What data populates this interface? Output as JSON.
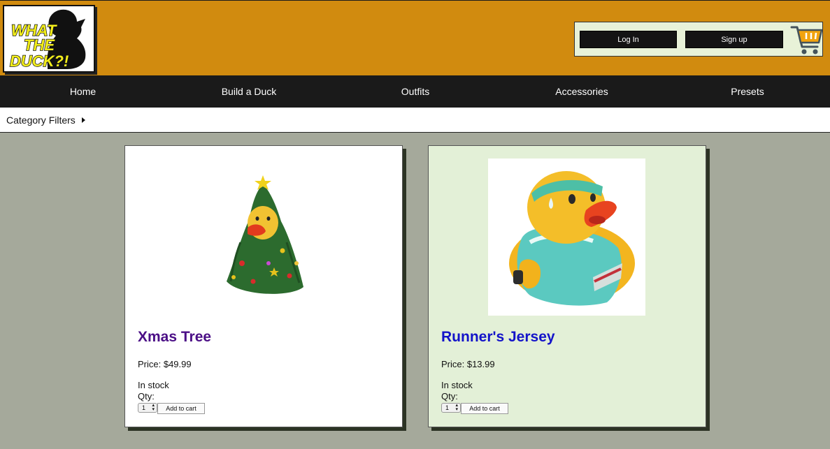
{
  "header": {
    "logo": {
      "text_lines": [
        "WHAT",
        "THE",
        "DUCK?!"
      ],
      "mark": "®",
      "icon": "duck-silhouette-icon"
    },
    "auth": {
      "login_label": "Log In",
      "signup_label": "Sign up"
    },
    "cart": {
      "icon": "shopping-cart-icon"
    }
  },
  "nav": {
    "items": [
      {
        "label": "Home"
      },
      {
        "label": "Build a Duck"
      },
      {
        "label": "Outfits"
      },
      {
        "label": "Accessories"
      },
      {
        "label": "Presets"
      }
    ]
  },
  "filters": {
    "label": "Category Filters",
    "icon": "caret-right-icon"
  },
  "products": [
    {
      "title": "Xmas Tree",
      "price": "Price: $49.99",
      "stock": "In stock",
      "qty_label": "Qty:",
      "qty_value": "1",
      "add_label": "Add to cart",
      "image_icon": "christmas-tree-duck-image"
    },
    {
      "title": "Runner's Jersey",
      "price": "Price: $13.99",
      "stock": "In stock",
      "qty_label": "Qty:",
      "qty_value": "1",
      "add_label": "Add to cart",
      "image_icon": "runner-duck-image"
    }
  ],
  "colors": {
    "header_bg": "#d18b0f",
    "nav_bg": "#1a1a1a",
    "page_bg": "#a5a99b",
    "visited_link": "#4b0f86",
    "link": "#1313c9"
  }
}
